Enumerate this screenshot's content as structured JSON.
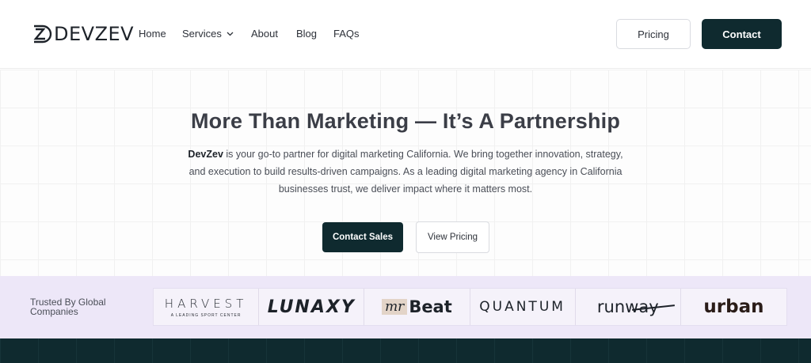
{
  "brand": {
    "name": "DEVZEV"
  },
  "nav": {
    "items": [
      {
        "label": "Home"
      },
      {
        "label": "Services"
      },
      {
        "label": "About"
      },
      {
        "label": "Blog"
      },
      {
        "label": "FAQs"
      }
    ],
    "pricing_label": "Pricing",
    "contact_label": "Contact"
  },
  "hero": {
    "title": "More Than Marketing — It’s A Partnership",
    "desc_brand": "DevZev",
    "desc_text": " is your go-to partner for digital marketing California. We bring together innovation, strategy, and execution to build results-driven campaigns. As a leading digital marketing agency in California businesses trust, we deliver impact where it matters most.",
    "primary_cta": "Contact Sales",
    "secondary_cta": "View Pricing"
  },
  "trusted": {
    "label": "Trusted By Global Companies",
    "logos": {
      "harvest_name": "HARVEST",
      "harvest_tag": "A LEADING SPORT CENTER",
      "lunaxy": "LUNAXY",
      "mr": "mr",
      "beat": "Beat",
      "quantum": "QUANTUM",
      "runway": "runway",
      "urban": "urban"
    }
  },
  "colors": {
    "accent_dark": "#0f2a2f",
    "trusted_bg": "#ede7f8"
  }
}
